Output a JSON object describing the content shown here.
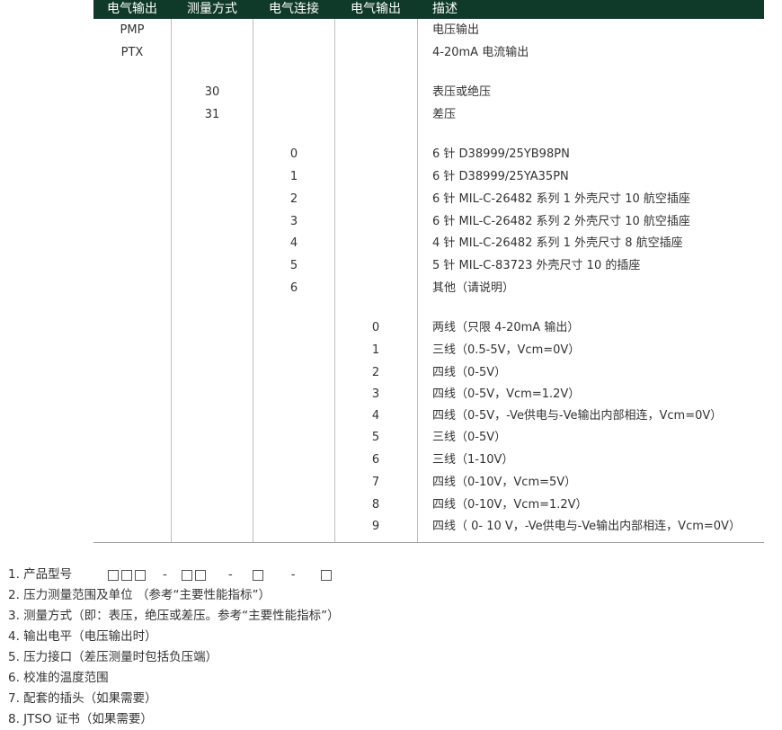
{
  "header": [
    "电气输出",
    "测量方式",
    "电气连接",
    "电气输出",
    "描述"
  ],
  "col1": [
    {
      "code": "PMP",
      "desc": "电压输出"
    },
    {
      "code": "PTX",
      "desc": "4-20mA 电流输出"
    }
  ],
  "col2": [
    {
      "code": "30",
      "desc": "表压或绝压"
    },
    {
      "code": "31",
      "desc": "差压"
    }
  ],
  "col3": [
    {
      "code": "0",
      "desc": "6 针 D38999/25YB98PN"
    },
    {
      "code": "1",
      "desc": "6 针 D38999/25YA35PN"
    },
    {
      "code": "2",
      "desc": "6 针 MIL-C-26482 系列 1 外壳尺寸 10 航空插座"
    },
    {
      "code": "3",
      "desc": "6 针 MIL-C-26482 系列 2 外壳尺寸 10 航空插座"
    },
    {
      "code": "4",
      "desc": "4 针 MIL-C-26482 系列 1 外壳尺寸 8 航空插座"
    },
    {
      "code": "5",
      "desc": "5 针 MIL-C-83723 外壳尺寸 10 的插座"
    },
    {
      "code": "6",
      "desc": "其他（请说明）"
    }
  ],
  "col4": [
    {
      "code": "0",
      "desc": "两线（只限 4-20mA 输出）"
    },
    {
      "code": "1",
      "desc": "三线（0.5-5V，Vcm=0V）"
    },
    {
      "code": "2",
      "desc": "四线（0-5V）"
    },
    {
      "code": "3",
      "desc": "四线（0-5V，Vcm=1.2V）"
    },
    {
      "code": "4",
      "desc": "四线（0-5V，-Ve供电与-Ve输出内部相连，Vcm=0V）"
    },
    {
      "code": "5",
      "desc": "三线（0-5V）"
    },
    {
      "code": "6",
      "desc": "三线（1-10V）"
    },
    {
      "code": "7",
      "desc": "四线（0-10V，Vcm=5V）"
    },
    {
      "code": "8",
      "desc": "四线（0-10V，Vcm=1.2V）"
    },
    {
      "code": "9",
      "desc": "四线（ 0- 10 V，-Ve供电与-Ve输出内部相连，Vcm=0V）"
    }
  ],
  "notes": {
    "model_label": "1. 产品型号",
    "dash": "-",
    "items": [
      "2. 压力测量范围及单位 （参考“主要性能指标”）",
      "3. 测量方式（即：表压，绝压或差压。参考“主要性能指标”）",
      "4. 输出电平（电压输出时）",
      "5. 压力接口（差压测量时包括负压端）",
      "6. 校准的温度范围",
      "7. 配套的插头（如果需要）",
      "8. JTSO 证书（如果需要）"
    ]
  }
}
